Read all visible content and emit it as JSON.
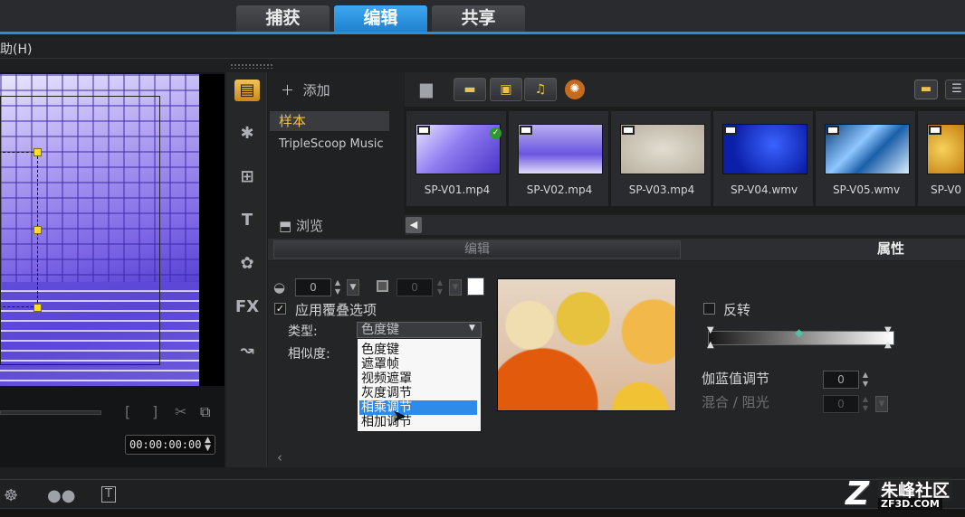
{
  "workspace_tabs": [
    {
      "label": "捕获",
      "active": false
    },
    {
      "label": "编辑",
      "active": true
    },
    {
      "label": "共享",
      "active": false
    }
  ],
  "menu": {
    "help": "助(H)"
  },
  "preview": {
    "timecode": "00:00:00:00"
  },
  "library": {
    "add_label": "添加",
    "folders": [
      "样本",
      "TripleScoop Music"
    ],
    "browse_label": "浏览",
    "thumbnails": [
      {
        "name": "SP-V01.mp4",
        "checked": true
      },
      {
        "name": "SP-V02.mp4"
      },
      {
        "name": "SP-V03.mp4"
      },
      {
        "name": "SP-V04.wmv"
      },
      {
        "name": "SP-V05.wmv"
      },
      {
        "name": "SP-V0"
      }
    ]
  },
  "options": {
    "tabs": {
      "edit": "编辑",
      "attributes": "属性"
    },
    "spin_value_1": "0",
    "spin_value_2": "0",
    "apply_overlay_label": "应用覆叠选项",
    "apply_overlay_checked": true,
    "type_label": "类型:",
    "type_selected": "色度键",
    "type_options": [
      "色度键",
      "遮罩帧",
      "视频遮罩",
      "灰度调节",
      "相乘调节",
      "相加调节"
    ],
    "type_highlighted_index": 4,
    "similarity_label": "相似度:",
    "reverse_label": "反转",
    "gamma_label": "伽蓝值调节",
    "gamma_value": "0",
    "blend_label": "混合 / 阻光",
    "blend_value": "0"
  },
  "watermark": {
    "title": "朱峰社区",
    "url": "ZF3D.COM"
  },
  "colors": {
    "accent": "#2c8fd6",
    "highlight": "#2e8bea",
    "folder_selected": "#f0c050"
  }
}
